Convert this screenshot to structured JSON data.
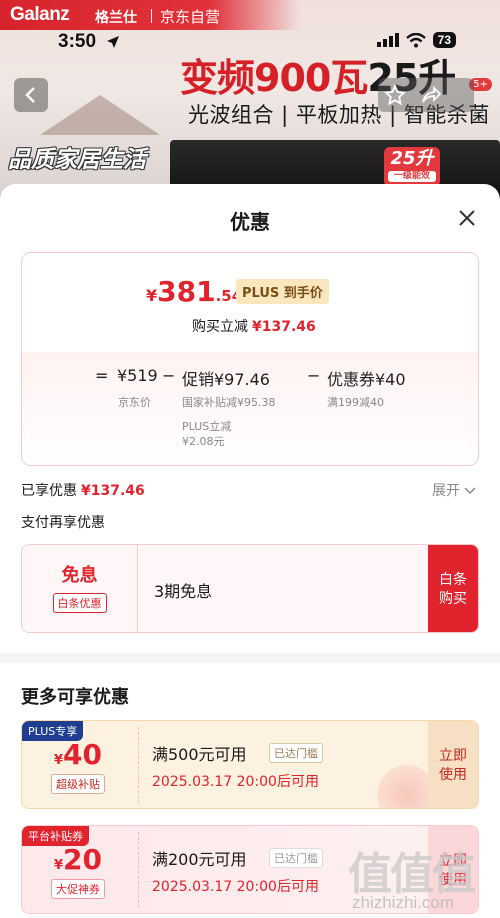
{
  "banner": {
    "brand_logo": "Galanz",
    "brand_cn": "格兰仕",
    "store": "京东自营",
    "headline_red": "变频900瓦",
    "headline_dark": "25升",
    "subline": "光波组合 | 平板加热 | 智能杀菌",
    "slogan": "品质家居生活",
    "appliance_badge": "25升",
    "appliance_badge_sub": "一级能效",
    "badge_count": "5+"
  },
  "status_bar": {
    "time": "3:50",
    "battery": "73"
  },
  "sheet": {
    "title": "优惠"
  },
  "price": {
    "currency": "¥",
    "integer": "381",
    "decimal": ".54",
    "plus_tag": "PLUS 到手价",
    "instant_label": "购买立减",
    "instant_amount": "¥137.46"
  },
  "breakdown": {
    "eq": "=",
    "jd_price": "¥519",
    "jd_price_label": "京东价",
    "minus1": "−",
    "promo": "促销¥97.46",
    "promo_sub1": "国家补贴减¥95.38",
    "promo_sub2": "PLUS立减",
    "promo_sub3": "¥2.08元",
    "minus2": "−",
    "coupon": "优惠券¥40",
    "coupon_sub": "满199减40"
  },
  "enjoyed": {
    "label": "已享优惠",
    "amount": "¥137.46",
    "expand": "展开"
  },
  "pay_more": "支付再享优惠",
  "baitiao": {
    "title": "免息",
    "tag": "白条优惠",
    "desc": "3期免息",
    "button_line1": "白条",
    "button_line2": "购买"
  },
  "more_title": "更多可享优惠",
  "coupons": [
    {
      "corner": "PLUS专享",
      "yen": "¥",
      "amount": "40",
      "sub": "超级补贴",
      "condition": "满500元可用",
      "met": "已达门槛",
      "date": "2025.03.17 20:00后可用",
      "action_line1": "立即",
      "action_line2": "使用"
    },
    {
      "corner": "平台补贴券",
      "yen": "¥",
      "amount": "20",
      "sub": "大促神券",
      "condition": "满200元可用",
      "met": "已达门槛",
      "date": "2025.03.17 20:00后可用",
      "action_line1": "立即",
      "action_line2": "使用"
    }
  ],
  "watermark": {
    "text": "值值值",
    "url": "zhizhizhi.com"
  },
  "colors": {
    "accent": "#e0232d",
    "plus_gold": "#fbe7bd",
    "plus_navy": "#1e3e8f"
  }
}
